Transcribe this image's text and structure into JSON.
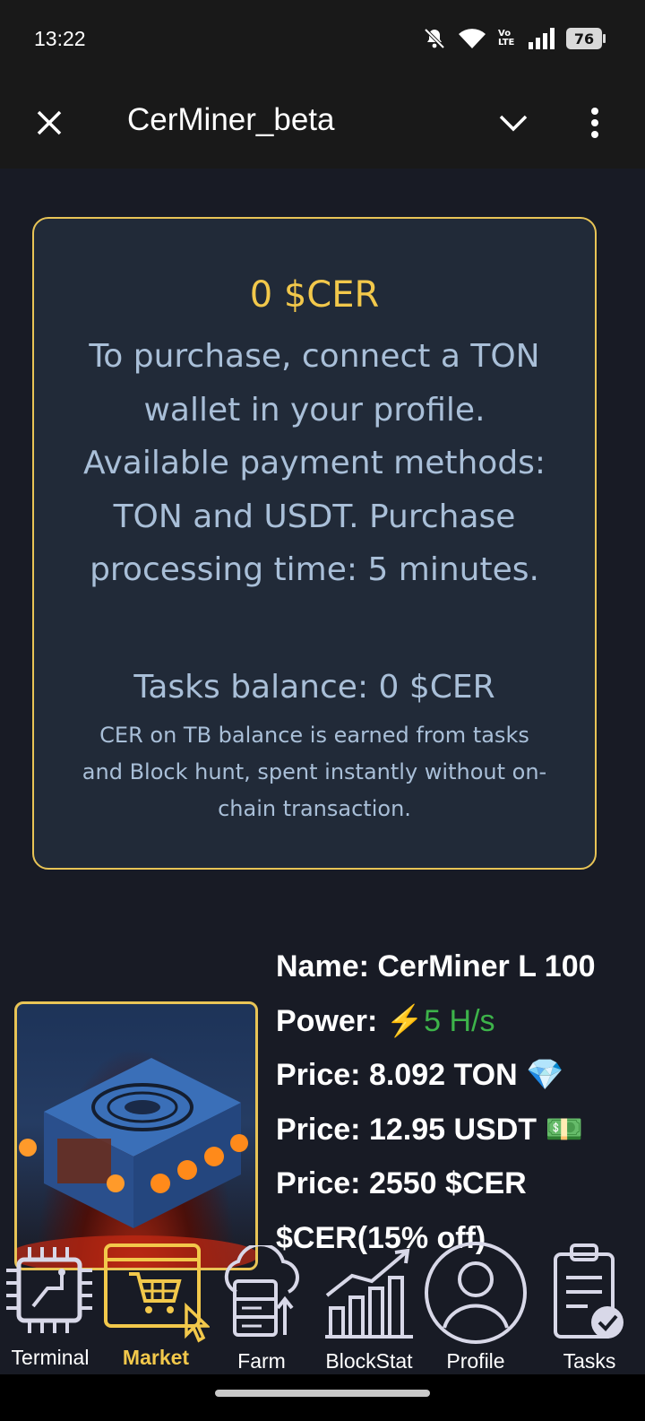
{
  "status_bar": {
    "time": "13:22",
    "battery": "76",
    "network": "Vo LTE"
  },
  "header": {
    "title": "CerMiner_beta"
  },
  "info_card": {
    "balance": "0 $CER",
    "purchase_text": "To purchase, connect a TON wallet in your profile. Available payment methods: TON and USDT. Purchase processing time: 5 minutes.",
    "tasks_balance": "Tasks balance: 0 $CER",
    "tb_note": "CER on TB balance is earned from tasks and Block hunt, spent instantly without on-chain transaction."
  },
  "product": {
    "name": "Name: CerMiner L 100",
    "power_label": "Power:",
    "power_icon": "⚡",
    "power_value": "5 H/s",
    "price_ton": "Price: 8.092 TON",
    "price_ton_icon": "💎",
    "price_usdt": "Price: 12.95 USDT",
    "price_usdt_icon": "💵",
    "price_cer": "Price: 2550 $CER",
    "discount": "$CER(15% off)"
  },
  "nav": [
    {
      "label": "Terminal",
      "icon": "chip-icon"
    },
    {
      "label": "Market",
      "icon": "cart-icon",
      "active": true
    },
    {
      "label": "Farm",
      "icon": "cloud-server-icon"
    },
    {
      "label": "BlockStat",
      "icon": "chart-icon"
    },
    {
      "label": "Profile",
      "icon": "user-icon"
    },
    {
      "label": "Tasks",
      "icon": "clipboard-icon"
    }
  ],
  "colors": {
    "accent": "#f2c84b",
    "card_bg": "#212a38",
    "text_muted": "#a9bfd8",
    "power_green": "#3db34a"
  }
}
